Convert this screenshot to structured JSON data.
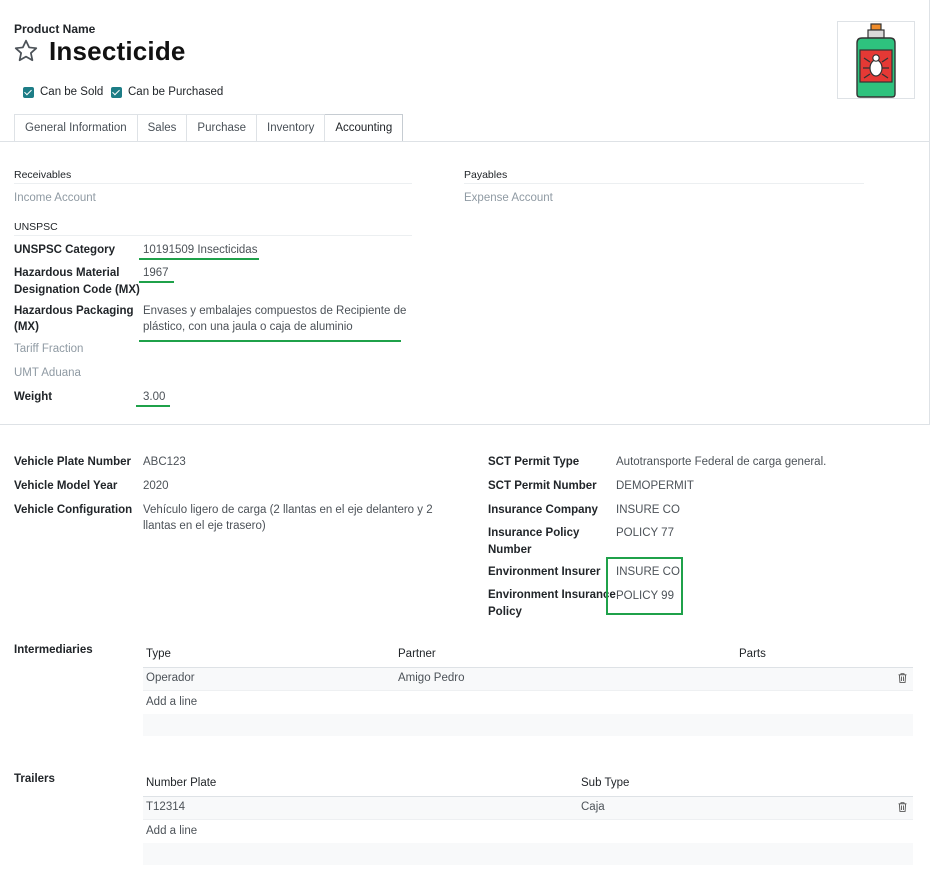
{
  "header": {
    "product_name_label": "Product Name",
    "title": "Insecticide",
    "can_be_sold": "Can be Sold",
    "can_be_purchased": "Can be Purchased"
  },
  "tabs": [
    {
      "label": "General Information"
    },
    {
      "label": "Sales"
    },
    {
      "label": "Purchase"
    },
    {
      "label": "Inventory"
    },
    {
      "label": "Accounting"
    }
  ],
  "accounting": {
    "receivables": "Receivables",
    "income_account": "Income Account",
    "payables": "Payables",
    "expense_account": "Expense Account",
    "unspsc": "UNSPSC",
    "unspsc_category_label": "UNSPSC Category",
    "unspsc_category_value": "10191509 Insecticidas",
    "hazardous_code_label_1": "Hazardous Material",
    "hazardous_code_label_2": "Designation Code (MX)",
    "hazardous_code_value": "1967",
    "hazardous_packaging_label_1": "Hazardous Packaging",
    "hazardous_packaging_label_2": "(MX)",
    "hazardous_packaging_value_1": "Envases y embalajes compuestos de Recipiente de",
    "hazardous_packaging_value_2": "plástico, con una jaula o caja de aluminio",
    "tariff_fraction": "Tariff Fraction",
    "umt_aduana": "UMT Aduana",
    "weight_label": "Weight",
    "weight_value": "3.00"
  },
  "vehicle": {
    "plate_label": "Vehicle Plate Number",
    "plate_value": "ABC123",
    "model_year_label": "Vehicle Model Year",
    "model_year_value": "2020",
    "config_label": "Vehicle Configuration",
    "config_value_1": "Vehículo ligero de carga (2 llantas en el eje delantero y 2",
    "config_value_2": "llantas en el eje trasero)",
    "sct_type_label": "SCT Permit Type",
    "sct_type_value": "Autotransporte Federal de carga general.",
    "sct_number_label": "SCT Permit Number",
    "sct_number_value": "DEMOPERMIT",
    "ins_company_label": "Insurance Company",
    "ins_company_value": "INSURE CO",
    "ins_policy_label_1": "Insurance Policy",
    "ins_policy_label_2": "Number",
    "ins_policy_value": "POLICY 77",
    "env_insurer_label": "Environment Insurer",
    "env_insurer_value": "INSURE CO",
    "env_policy_label_1": "Environment Insurance",
    "env_policy_label_2": "Policy",
    "env_policy_value": "POLICY 99"
  },
  "intermediaries": {
    "label": "Intermediaries",
    "columns": [
      "Type",
      "Partner",
      "Parts"
    ],
    "rows": [
      [
        "Operador",
        "Amigo Pedro",
        ""
      ]
    ],
    "add_line": "Add a line"
  },
  "trailers": {
    "label": "Trailers",
    "columns": [
      "Number Plate",
      "Sub Type"
    ],
    "rows": [
      [
        "T12314",
        "Caja"
      ]
    ],
    "add_line": "Add a line"
  },
  "colors": {
    "accent": "#1d7d86",
    "highlight_green": "#1fa14a"
  }
}
